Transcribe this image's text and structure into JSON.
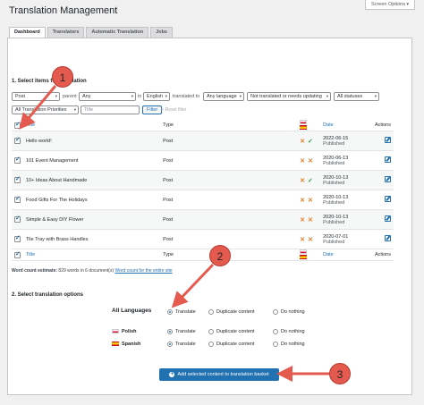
{
  "header": {
    "screen_options": "Screen Options",
    "title": "Translation Management"
  },
  "tabs": [
    {
      "label": "Dashboard",
      "active": true
    },
    {
      "label": "Translators",
      "active": false
    },
    {
      "label": "Automatic Translation",
      "active": false
    },
    {
      "label": "Jobs",
      "active": false
    }
  ],
  "section1": {
    "title": "1. Select items for translation",
    "filters": {
      "type": "Post",
      "parent_label": "parent",
      "parent": "Any",
      "in_label": "in",
      "lang": "English",
      "translated_to_label": "translated to",
      "target_lang": "Any language",
      "status": "Not translated or needs updating",
      "all_statuses": "All statuses",
      "priorities": "All Translation Priorities",
      "title_placeholder": "Title",
      "filter_button": "Filter",
      "reset_label": "Reset filter"
    },
    "table": {
      "col_title": "Title",
      "col_type": "Type",
      "col_date": "Date",
      "col_actions": "Actions",
      "rows": [
        {
          "title": "Hello world!",
          "type": "Post",
          "date": "2022-06-15",
          "status": "Published",
          "pl": "x",
          "es": "ok"
        },
        {
          "title": "101 Event Management",
          "type": "Post",
          "date": "2020-06-13",
          "status": "Published",
          "pl": "x",
          "es": "x"
        },
        {
          "title": "10+ Ideas About Handmade",
          "type": "Post",
          "date": "2020-10-13",
          "status": "Published",
          "pl": "x",
          "es": "ok"
        },
        {
          "title": "Food Gifts For The Holidays",
          "type": "Post",
          "date": "2020-10-13",
          "status": "Published",
          "pl": "x",
          "es": "x"
        },
        {
          "title": "Simple & Easy DIY Flower",
          "type": "Post",
          "date": "2020-10-13",
          "status": "Published",
          "pl": "x",
          "es": "x"
        },
        {
          "title": "Tile Tray with Brass Handles",
          "type": "Post",
          "date": "2020-07-01",
          "status": "Published",
          "pl": "x",
          "es": "x"
        }
      ]
    },
    "word_count": {
      "prefix": "Word count estimate:",
      "text": "829 words in 6 document(s)",
      "link": "Word count for the entire site"
    }
  },
  "section2": {
    "title": "2. Select translation options",
    "all_languages": "All Languages",
    "options": [
      "Translate",
      "Duplicate content",
      "Do nothing"
    ],
    "languages": [
      {
        "name": "Polish",
        "selected": "Translate"
      },
      {
        "name": "Spanish",
        "selected": "Translate"
      }
    ],
    "add_button": "Add selected content to translation basket"
  },
  "annotations": [
    "1",
    "2",
    "3"
  ],
  "colors": {
    "accent": "#2271b1",
    "callout": "#e55a4e"
  }
}
